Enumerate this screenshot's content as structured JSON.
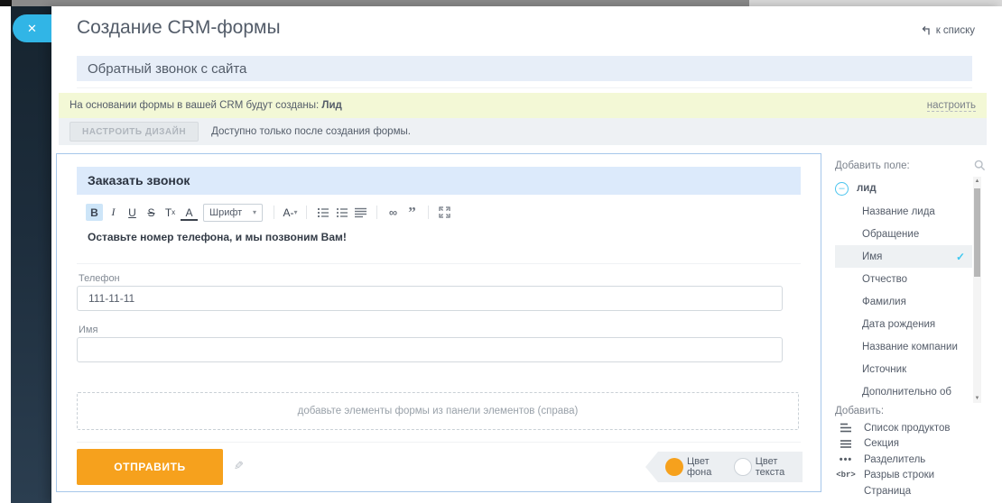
{
  "window": {
    "close_icon": "✕"
  },
  "header": {
    "title": "Создание CRM-формы",
    "back_to_list": "к списку"
  },
  "form_name": {
    "value": "Обратный звонок с сайта"
  },
  "notice": {
    "text": "На основании формы в вашей CRM будут созданы:",
    "entity": "Лид",
    "configure": "настроить"
  },
  "design": {
    "button": "НАСТРОИТЬ ДИЗАЙН",
    "hint": "Доступно только после создания формы."
  },
  "editor": {
    "title": "Заказать звонок",
    "toolbar": {
      "bold": "B",
      "italic": "I",
      "underline": "U",
      "strike": "S",
      "clear_t": "T",
      "clear_x": "x",
      "text_color": "A",
      "font": "Шрифт",
      "font_size": "A-"
    },
    "description": "Оставьте номер телефона, и мы позвоним Вам!",
    "fields": [
      {
        "label": "Телефон",
        "value": "111-11-11"
      },
      {
        "label": "Имя",
        "value": ""
      }
    ],
    "dropzone": "добавьте элементы формы из панели элементов (справа)",
    "submit": "ОТПРАВИТЬ",
    "bg_color_label": "Цвет фона",
    "text_color_label": "Цвет текста"
  },
  "panel": {
    "add_field_label": "Добавить поле:",
    "group_name": "лид",
    "fields": [
      {
        "label": "Название лида",
        "selected": false
      },
      {
        "label": "Обращение",
        "selected": false
      },
      {
        "label": "Имя",
        "selected": true
      },
      {
        "label": "Отчество",
        "selected": false
      },
      {
        "label": "Фамилия",
        "selected": false
      },
      {
        "label": "Дата рождения",
        "selected": false
      },
      {
        "label": "Название компании",
        "selected": false
      },
      {
        "label": "Источник",
        "selected": false
      },
      {
        "label": "Дополнительно об",
        "selected": false
      }
    ],
    "add_label": "Добавить:",
    "add_items": [
      {
        "label": "Список продуктов"
      },
      {
        "label": "Секция"
      },
      {
        "label": "Разделитель"
      },
      {
        "label": "Разрыв строки"
      },
      {
        "label": "Страница"
      }
    ]
  },
  "icons": {
    "check": "✓",
    "quote": "”",
    "link": "∞",
    "pencil": "✎",
    "dots": "•••",
    "br_tag": "<br>",
    "caret": "▾",
    "scroll_up": "▲",
    "scroll_down": "▼",
    "minus": "–"
  },
  "colors": {
    "accent_orange": "#f6a11d",
    "accent_blue": "#31b5e6",
    "accent_teal": "#3fc8f0",
    "notice_bg": "#f3f8d6",
    "form_title_bg": "#dceafb",
    "form_name_bg": "#e7eef8",
    "card_border": "#a6c7ea"
  }
}
